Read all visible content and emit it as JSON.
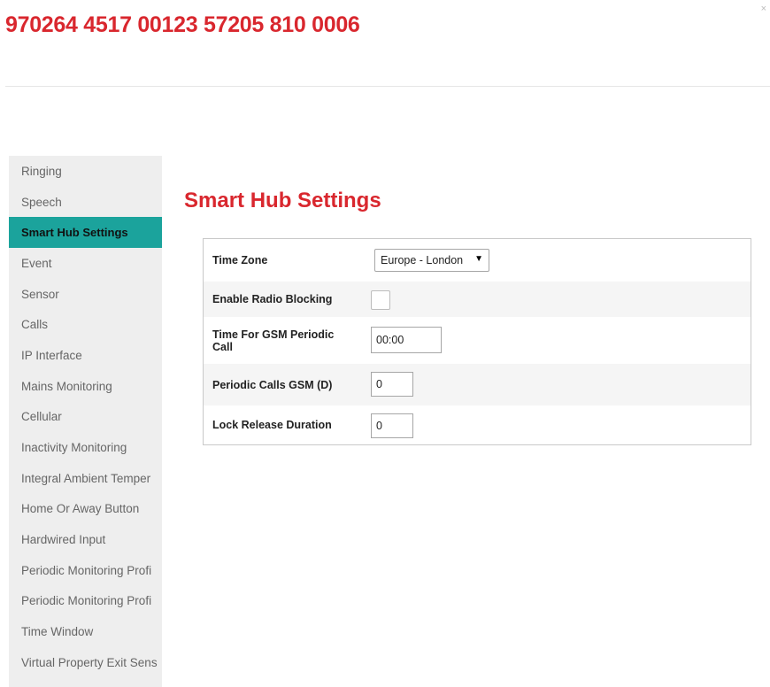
{
  "header": {
    "title": "970264 4517 00123 57205 810 0006",
    "close_glyph": "×"
  },
  "sidebar": {
    "items": [
      {
        "label": "Ringing"
      },
      {
        "label": "Speech"
      },
      {
        "label": "Smart Hub Settings",
        "active": true
      },
      {
        "label": "Event"
      },
      {
        "label": "Sensor"
      },
      {
        "label": "Calls"
      },
      {
        "label": "IP Interface"
      },
      {
        "label": "Mains Monitoring"
      },
      {
        "label": "Cellular"
      },
      {
        "label": "Inactivity Monitoring"
      },
      {
        "label": "Integral Ambient Temper"
      },
      {
        "label": "Home Or Away Button"
      },
      {
        "label": "Hardwired Input"
      },
      {
        "label": "Periodic Monitoring Profi"
      },
      {
        "label": "Periodic Monitoring Profi"
      },
      {
        "label": "Time Window"
      },
      {
        "label": "Virtual Property Exit Sens"
      }
    ]
  },
  "main": {
    "page_title": "Smart Hub Settings",
    "settings": {
      "time_zone": {
        "label": "Time Zone",
        "value": "Europe - London"
      },
      "radio_blocking": {
        "label": "Enable Radio Blocking",
        "checked": false
      },
      "gsm_periodic_call": {
        "label": "Time For GSM Periodic Call",
        "value": "00:00"
      },
      "periodic_calls_gsm": {
        "label": "Periodic Calls GSM (D)",
        "value": "0"
      },
      "lock_release": {
        "label": "Lock Release Duration",
        "value": "0"
      }
    }
  },
  "colors": {
    "accent_red": "#d9272e",
    "active_teal": "#1ba39c",
    "sidebar_bg": "#eeeeee"
  },
  "icons": {
    "close": "close-icon",
    "dropdown": "dropdown-arrow-icon"
  }
}
